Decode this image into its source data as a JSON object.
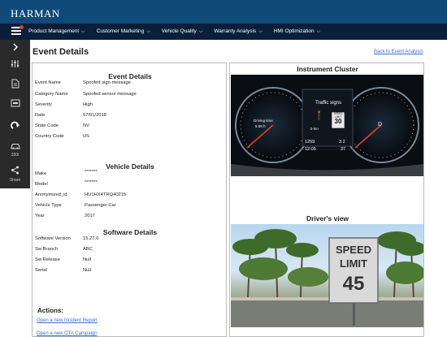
{
  "header": {
    "logo": "HARMAN"
  },
  "nav": {
    "items": [
      "Product Management",
      "Customer Marketing",
      "Vehicle Quality",
      "Warranty Analysis",
      "HMI Optimization"
    ]
  },
  "sidebar": {
    "items": [
      {
        "icon": "chevron-right-icon"
      },
      {
        "icon": "sliders-icon"
      },
      {
        "icon": "document-icon"
      },
      {
        "icon": "dlc-icon"
      },
      {
        "icon": "redo-icon"
      },
      {
        "icon": "car-icon",
        "label": "330i"
      },
      {
        "icon": "share-icon",
        "label": "Share"
      }
    ]
  },
  "page": {
    "title": "Event Details",
    "back_link": "Back to Event Analysis"
  },
  "event_details": {
    "title": "Event Details",
    "rows": [
      {
        "label": "Event Name",
        "value": "Spoofed sign message"
      },
      {
        "label": "Category Name",
        "value": "Spoofed sensor message"
      },
      {
        "label": "Severity",
        "value": "High"
      },
      {
        "label": "Date",
        "value": "07/01/2018"
      },
      {
        "label": "State Code",
        "value": "NV"
      },
      {
        "label": "Country Code",
        "value": "US"
      }
    ]
  },
  "vehicle_details": {
    "title": "Vehicle Details",
    "rows": [
      {
        "label": "Make",
        "value": "*******"
      },
      {
        "label": "Model",
        "value": "*******"
      },
      {
        "label": "Anonymized_id",
        "value": "HU1HX4TRQ40215"
      },
      {
        "label": "Vehicle Type",
        "value": "Passenger Car"
      },
      {
        "label": "Year",
        "value": "2017"
      }
    ]
  },
  "software_details": {
    "title": "Software Details",
    "rows": [
      {
        "label": "Software Version",
        "value": "15.27.0"
      },
      {
        "label": "Sw Branch",
        "value": "ABC"
      },
      {
        "label": "Sw Release",
        "value": "Null"
      },
      {
        "label": "Serial",
        "value": "Null"
      }
    ]
  },
  "actions": {
    "title": "Actions:",
    "links": [
      "Open a new Incident Report",
      "Open a new OTA Campaign"
    ]
  },
  "instrument_cluster": {
    "title": "Instrument Cluster",
    "center_label": "Traffic signs",
    "driving_time_label": "Driving time",
    "driving_time": "5:58 h",
    "distance": "5 km",
    "sign_top": "SPEED LIMIT",
    "sign_value": "30",
    "odometer": "1259",
    "temp": "3.2",
    "clock": "12:05",
    "outside_temp": "37",
    "gear": "D"
  },
  "drivers_view": {
    "title": "Driver's view",
    "sign_line1": "SPEED",
    "sign_line2": "LIMIT",
    "sign_value": "45"
  },
  "colors": {
    "topbar": "#0f4a78",
    "navbar": "#0b1f3a",
    "sidebar": "#2a2a2a",
    "link": "#3a70c8"
  }
}
